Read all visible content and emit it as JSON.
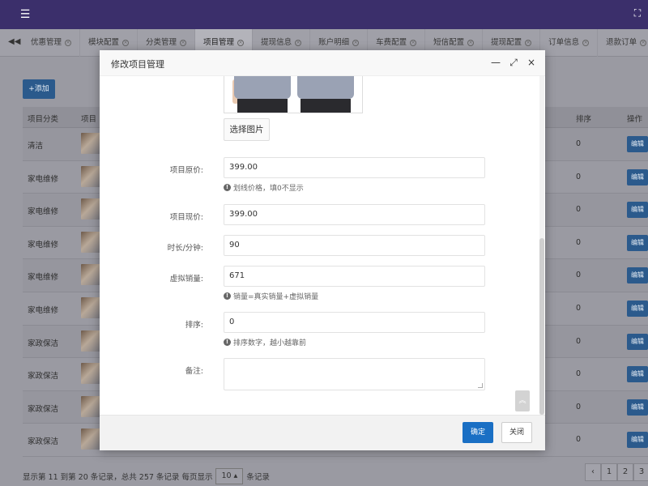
{
  "topbar": {
    "menu_icon": "hamburger-icon",
    "expand_icon": "fullscreen-icon"
  },
  "tabs": [
    {
      "label": "优惠管理",
      "active": false
    },
    {
      "label": "模块配置",
      "active": false
    },
    {
      "label": "分类管理",
      "active": false
    },
    {
      "label": "项目管理",
      "active": true
    },
    {
      "label": "提现信息",
      "active": false
    },
    {
      "label": "账户明细",
      "active": false
    },
    {
      "label": "车费配置",
      "active": false
    },
    {
      "label": "短信配置",
      "active": false
    },
    {
      "label": "提现配置",
      "active": false
    },
    {
      "label": "订单信息",
      "active": false
    },
    {
      "label": "退款订单",
      "active": false
    }
  ],
  "toolbar": {
    "add_label": "+添加"
  },
  "table": {
    "headers": {
      "category": "项目分类",
      "project": "项目",
      "sort": "排序",
      "action": "操作"
    },
    "rows": [
      {
        "category": "清洁",
        "sort": "0",
        "action": "编辑"
      },
      {
        "category": "家电维修",
        "sort": "0",
        "action": "编辑"
      },
      {
        "category": "家电维修",
        "sort": "0",
        "action": "编辑"
      },
      {
        "category": "家电维修",
        "sort": "0",
        "action": "编辑"
      },
      {
        "category": "家电维修",
        "sort": "0",
        "action": "编辑"
      },
      {
        "category": "家电维修",
        "sort": "0",
        "action": "编辑"
      },
      {
        "category": "家政保洁",
        "sort": "0",
        "action": "编辑"
      },
      {
        "category": "家政保洁",
        "sort": "0",
        "action": "编辑"
      },
      {
        "category": "家政保洁",
        "sort": "0",
        "action": "编辑"
      },
      {
        "category": "家政保洁",
        "sort": "0",
        "action": "编辑"
      }
    ]
  },
  "footer": {
    "info_prefix": "显示第 11 到第 20 条记录，总共 257 条记录 每页显示",
    "page_size": "10 ▴",
    "info_suffix": "条记录",
    "pager": {
      "prev": "‹",
      "p1": "1",
      "p2": "2",
      "p3": "3"
    }
  },
  "modal": {
    "title": "修改项目管理",
    "choose_image": "选择图片",
    "fields": {
      "original_price": {
        "label": "项目原价:",
        "value": "399.00",
        "help": "划线价格，填0不显示"
      },
      "current_price": {
        "label": "项目现价:",
        "value": "399.00"
      },
      "duration": {
        "label": "时长/分钟:",
        "value": "90"
      },
      "virtual_sales": {
        "label": "虚拟销量:",
        "value": "671",
        "help": "销量=真实销量+虚拟销量"
      },
      "sort": {
        "label": "排序:",
        "value": "0",
        "help": "排序数字，越小越靠前"
      },
      "remark": {
        "label": "备注:",
        "value": ""
      }
    },
    "ok_label": "确定",
    "close_label": "关闭",
    "controls": {
      "minimize": "—",
      "maximize": "⤢",
      "close": "×"
    },
    "back_top": "︽"
  }
}
